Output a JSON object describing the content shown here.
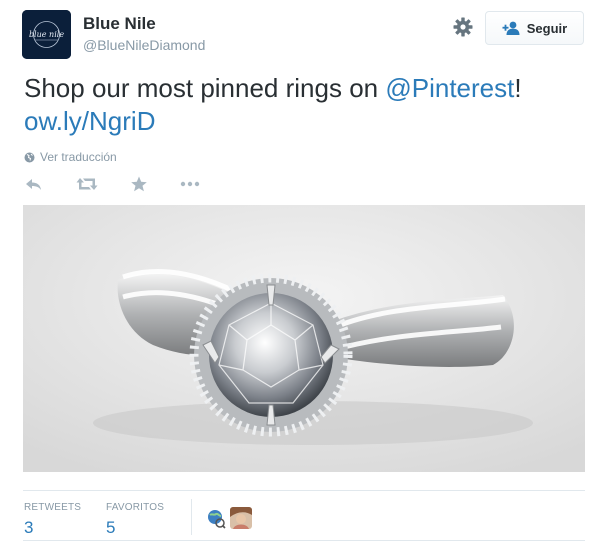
{
  "account": {
    "name": "Blue Nile",
    "handle": "@BlueNileDiamond",
    "logo_text": "blue nile"
  },
  "header": {
    "follow_label": "Seguir",
    "settings_icon": "gear-icon",
    "follow_icon": "add-user-icon"
  },
  "tweet": {
    "text_prefix": "Shop our most pinned rings on ",
    "mention": "@Pinterest",
    "text_suffix": "!",
    "link": "ow.ly/NgriD",
    "translate_label": "Ver traducción"
  },
  "actions": {
    "reply_icon": "reply-icon",
    "retweet_icon": "retweet-icon",
    "favorite_icon": "star-icon",
    "more_icon": "more-icon"
  },
  "stats": {
    "retweets_label": "RETWEETS",
    "retweets_value": "3",
    "favorites_label": "FAVORITOS",
    "favorites_value": "5"
  },
  "colors": {
    "link": "#2b7bb9",
    "muted": "#8899a6",
    "text": "#292f33",
    "logo_bg": "#0b1f3a"
  }
}
